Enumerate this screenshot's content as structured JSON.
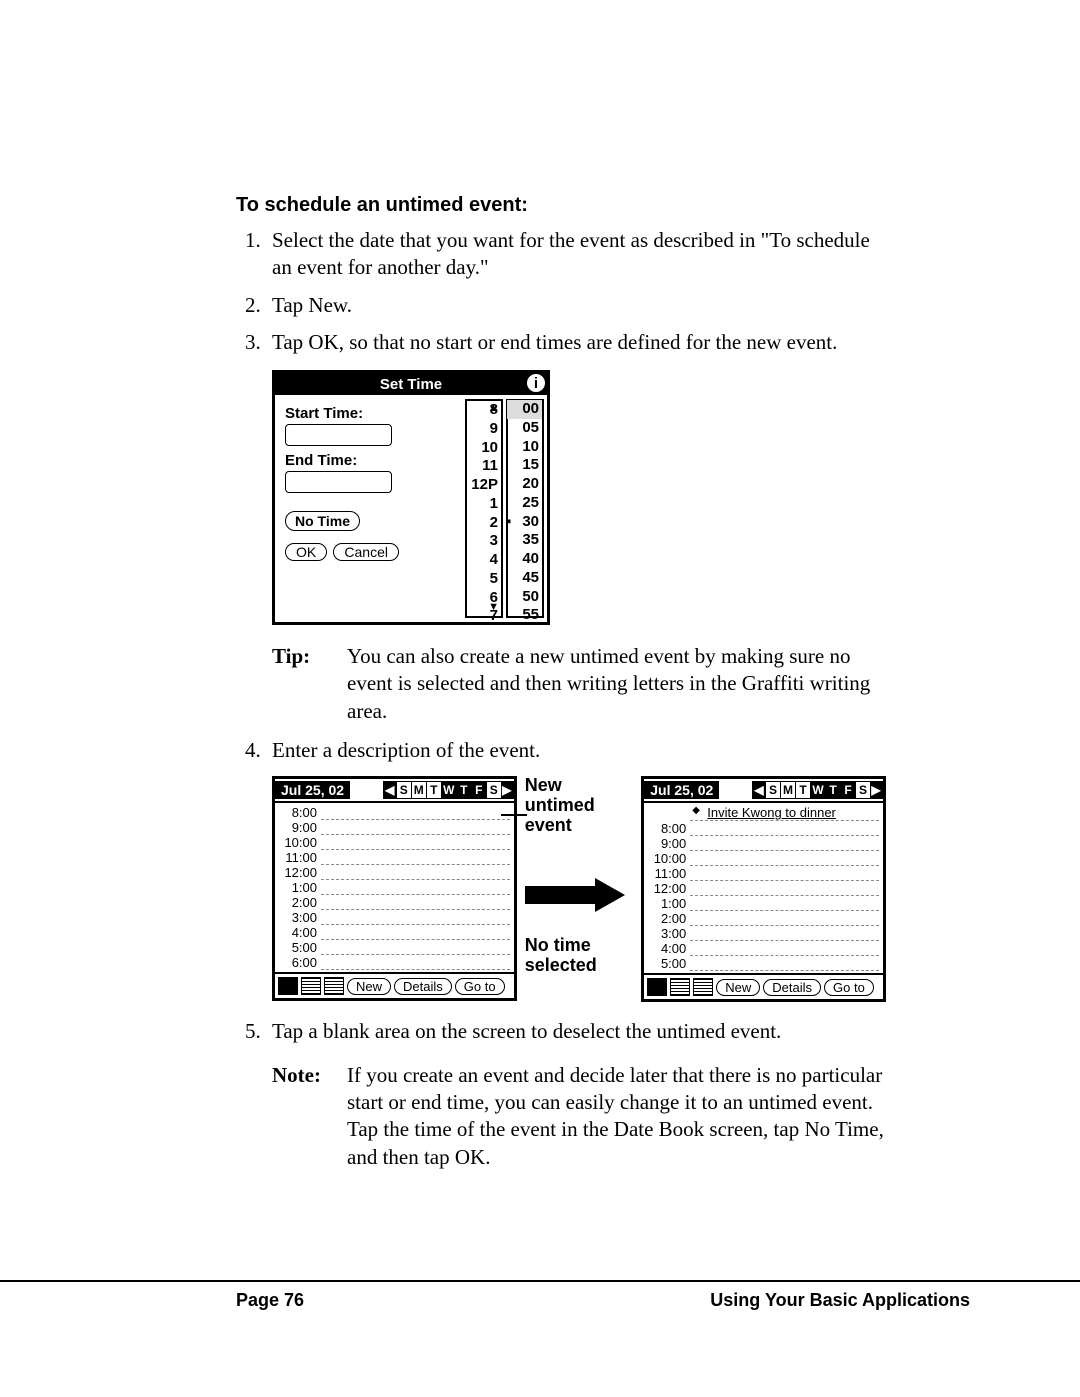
{
  "heading": "To schedule an untimed event:",
  "steps": [
    "Select the date that you want for the event as described in \"To schedule an event for another day.\"",
    "Tap New.",
    "Tap OK, so that no start or end times are defined for the new event.",
    "Enter a description of the event.",
    "Tap a blank area on the screen to deselect the untimed event."
  ],
  "fig1": {
    "title": "Set Time",
    "start_label": "Start Time:",
    "end_label": "End Time:",
    "notime": "No Time",
    "ok": "OK",
    "cancel": "Cancel",
    "hours": [
      "8",
      "9",
      "10",
      "11",
      "12P",
      "1",
      "2",
      "3",
      "4",
      "5",
      "6",
      "7"
    ],
    "mins": [
      "00",
      "05",
      "10",
      "15",
      "20",
      "25",
      "30",
      "35",
      "40",
      "45",
      "50",
      "55"
    ]
  },
  "tip": {
    "label": "Tip:",
    "text": "You can also create a new untimed event by making sure no event is selected and then writing letters in the Graffiti writing area."
  },
  "fig2": {
    "date": "Jul 25, 02",
    "days": [
      "S",
      "M",
      "T",
      "W",
      "T",
      "F",
      "S"
    ],
    "left_times": [
      "8:00",
      "9:00",
      "10:00",
      "11:00",
      "12:00",
      "1:00",
      "2:00",
      "3:00",
      "4:00",
      "5:00",
      "6:00"
    ],
    "right_times": [
      "8:00",
      "9:00",
      "10:00",
      "11:00",
      "12:00",
      "1:00",
      "2:00",
      "3:00",
      "4:00",
      "5:00"
    ],
    "untimed_event": "Invite Kwong to dinner",
    "btn_new": "New",
    "btn_details": "Details",
    "btn_goto": "Go to",
    "mid_label1": "New untimed event",
    "mid_label2": "No time selected"
  },
  "note": {
    "label": "Note:",
    "text": "If you create an event and decide later that there is no particular start or end time, you can easily change it to an untimed event. Tap the time of the event in the Date Book screen, tap No Time, and then tap OK."
  },
  "footer": {
    "left": "Page 76",
    "right": "Using Your Basic Applications"
  }
}
